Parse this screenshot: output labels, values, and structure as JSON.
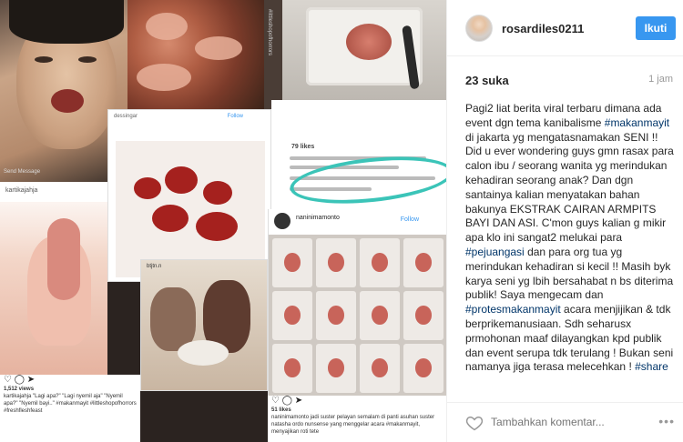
{
  "post": {
    "username": "rosardiles0211",
    "follow_label": "Ikuti",
    "likes": "23 suka",
    "time": "1 jam",
    "comment_parts": [
      {
        "t": "Pagi2 liat berita viral terbaru dimana ada event dgn tema kanibalisme "
      },
      {
        "t": "#makanmayit",
        "tag": true
      },
      {
        "t": " di jakarta yg mengatasnamakan SENI !! Did u ever wondering guys gmn rasax para calon ibu / seorang wanita yg merindukan kehadiran seorang anak? Dan dgn santainya kalian menyatakan bahan bakunya EKSTRAK CAIRAN ARMPITS BAYI DAN ASI. C'mon guys kalian g mikir apa klo ini sangat2 melukai para "
      },
      {
        "t": "#pejuangasi",
        "tag": true
      },
      {
        "t": " dan para org tua yg merindukan kehadiran si kecil !! Masih byk karya seni yg lbih bersahabat n bs diterima publik! Saya mengecam dan "
      },
      {
        "t": "#protesmakanmayit",
        "tag": true
      },
      {
        "t": " acara menjijikan & tdk berprikemanusiaan. Sdh seharusx prmohonan maaf dilayangkan kpd publik dan event serupa tdk terulang ! Bukan seni namanya jiga terasa melecehkan ! "
      },
      {
        "t": "#share",
        "tag": true
      }
    ],
    "comment_placeholder": "Tambahkan komentar...",
    "more_label": "•••"
  },
  "collage": {
    "send_message": "Send Message",
    "post1_user": "dessingar",
    "post1_follow": "Follow",
    "comm_likes": "79 likes",
    "brains_user": "naninimamonto",
    "brains_follow": "Follow",
    "pink_user": "kartikajahja",
    "kitchen_user": "btjtn.n",
    "cap_left_views": "1,512 views",
    "cap_left_text": "kartikajahja \"Lagi apa?\" \"Lagi nyemil aja\" \"Nyemil apa?\" \"Nyemil bayi..\" #makanmayit #littleshopofhorrors #freshfleshfeast",
    "cap_right_likes": "51 likes",
    "cap_right_text": "naninimamonto jadi suster pelayan semalam di panti asuhan suster natasha ordo nunsense yang menggelar acara #makanmayit, menyajikan roti tete"
  },
  "icons": {
    "heart": "heart-icon",
    "comment": "comment-icon",
    "share": "share-icon",
    "more": "more-icon"
  },
  "colors": {
    "follow_button": "#3897f0",
    "hashtag": "#003569",
    "highlight_ring": "#3bc4b8"
  }
}
